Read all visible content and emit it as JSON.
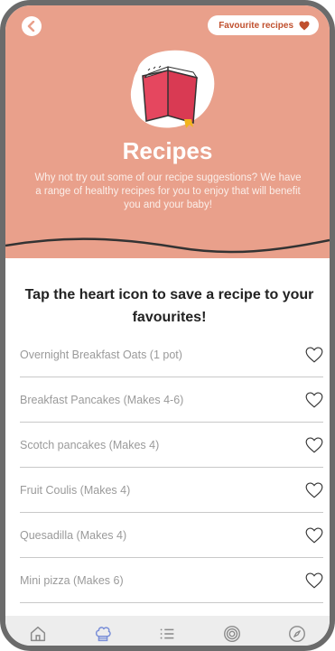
{
  "header": {
    "favourite_button_label": "Favourite recipes",
    "title": "Recipes",
    "intro": "Why not try out some of our recipe suggestions? We have a range of healthy recipes for you to enjoy that will benefit you and your baby!"
  },
  "instruction": "Tap the heart icon to save a recipe to your favourites!",
  "recipes": [
    {
      "label": "Overnight Breakfast Oats (1 pot)"
    },
    {
      "label": "Breakfast Pancakes (Makes 4-6)"
    },
    {
      "label": "Scotch pancakes (Makes 4)"
    },
    {
      "label": "Fruit Coulis (Makes 4)"
    },
    {
      "label": "Quesadilla (Makes 4)"
    },
    {
      "label": "Mini pizza (Makes 6)"
    }
  ],
  "tabs": [
    {
      "icon": "home-icon"
    },
    {
      "icon": "chef-hat-icon",
      "active": true
    },
    {
      "icon": "list-icon"
    },
    {
      "icon": "target-icon"
    },
    {
      "icon": "compass-icon"
    }
  ],
  "colors": {
    "header_bg": "#e9a08b",
    "accent": "#c0502e",
    "active_tab": "#7a8fd8"
  }
}
